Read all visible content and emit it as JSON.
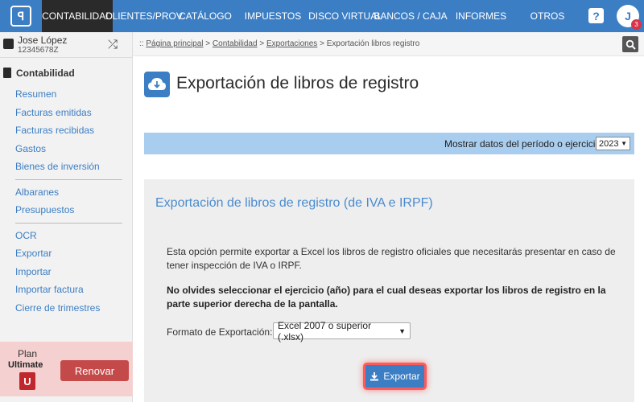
{
  "nav": {
    "items": [
      {
        "label": "CONTABILIDAD",
        "active": true
      },
      {
        "label": "CLIENTES/PROV."
      },
      {
        "label": "CATÁLOGO"
      },
      {
        "label": "IMPUESTOS"
      },
      {
        "label": "DISCO VIRTUAL"
      },
      {
        "label": "BANCOS / CAJA"
      },
      {
        "label": "INFORMES"
      },
      {
        "label": "OTROS"
      }
    ],
    "help_label": "?",
    "avatar_initial": "J",
    "notification_count": "3"
  },
  "user": {
    "name": "Jose López",
    "id": "12345678Z"
  },
  "sidebar": {
    "section_title": "Contabilidad",
    "group1": [
      "Resumen",
      "Facturas emitidas",
      "Facturas recibidas",
      "Gastos",
      "Bienes de inversión"
    ],
    "group2": [
      "Albaranes",
      "Presupuestos"
    ],
    "group3": [
      "OCR",
      "Exportar",
      "Importar",
      "Importar factura",
      "Cierre de trimestres"
    ]
  },
  "plan": {
    "label": "Plan",
    "name": "Ultimate",
    "icon_letter": "U",
    "renew_label": "Renovar"
  },
  "breadcrumb": {
    "prefix": "::",
    "items": [
      "Página principal",
      "Contabilidad",
      "Exportaciones",
      "Exportación libros registro"
    ],
    "separator": ">"
  },
  "page": {
    "title": "Exportación de libros de registro"
  },
  "period": {
    "label": "Mostrar datos del período o ejercicio",
    "selected": "2023"
  },
  "panel": {
    "title": "Exportación de libros de registro (de IVA e IRPF)",
    "description": "Esta opción permite exportar a Excel los libros de registro oficiales que necesitarás presentar en caso de tener inspección de IVA o IRPF.",
    "warning": "No olvides seleccionar el ejercicio (año) para el cual deseas exportar los libros de registro en la parte superior derecha de la pantalla.",
    "format_label": "Formato de Exportación:",
    "format_selected": "Excel 2007 o superior (.xlsx)",
    "export_label": "Exportar"
  },
  "colors": {
    "nav_bg": "#3c7ec4",
    "nav_active": "#2a2a2a",
    "link": "#3c7ec4",
    "panel_title": "#4a8bd0",
    "renew": "#c44a4a",
    "highlight": "#ff5a5a"
  }
}
